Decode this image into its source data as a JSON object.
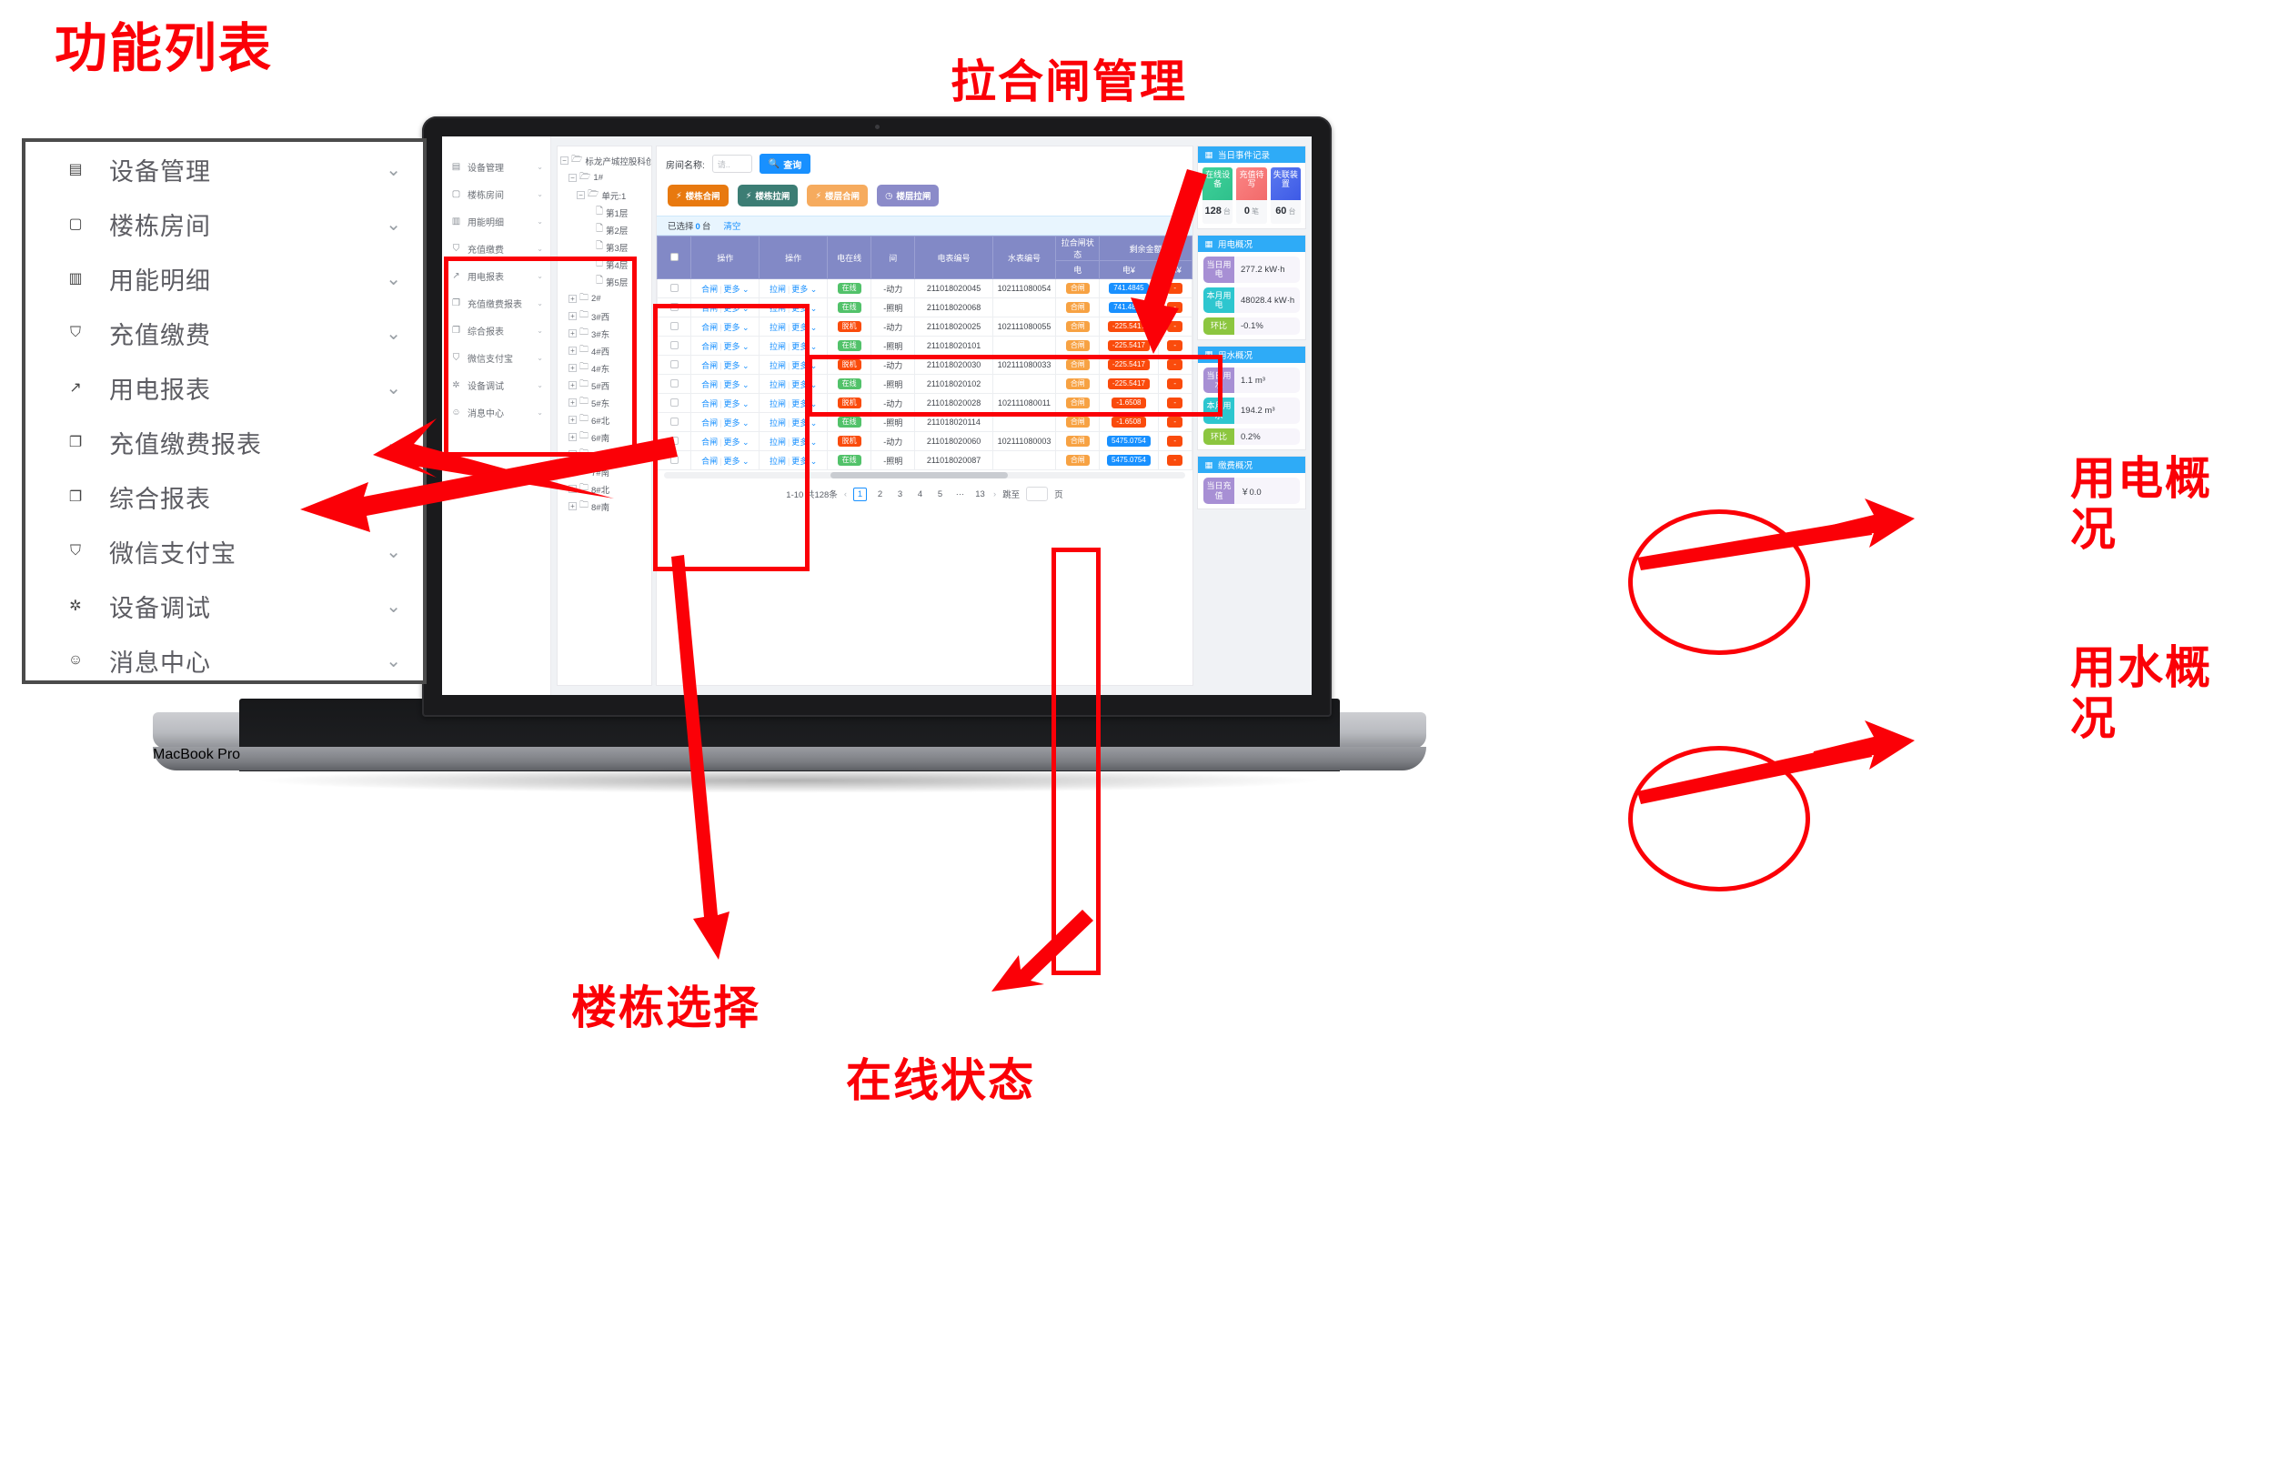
{
  "annotations": {
    "func_list": "功能列表",
    "gate_mgmt": "拉合闸管理",
    "power_overview": "用电概\n况",
    "water_overview": "用水概\n况",
    "building_select": "楼栋选择",
    "online_status": "在线状态"
  },
  "laptop": {
    "model_label": "MacBook Pro"
  },
  "func_list_panel": {
    "items": [
      {
        "label": "设备管理",
        "icon": "server-icon",
        "chevron": "chevron-down-icon"
      },
      {
        "label": "楼栋房间",
        "icon": "building-icon",
        "chevron": "chevron-down-icon"
      },
      {
        "label": "用能明细",
        "icon": "bar-chart-icon",
        "chevron": "chevron-down-icon"
      },
      {
        "label": "充值缴费",
        "icon": "shield-yen-icon",
        "chevron": "chevron-down-icon"
      },
      {
        "label": "用电报表",
        "icon": "trend-up-icon",
        "chevron": "chevron-down-icon"
      },
      {
        "label": "充值缴费报表",
        "icon": "copy-icon",
        "chevron": "chevron-down-icon"
      },
      {
        "label": "综合报表",
        "icon": "copy-icon",
        "chevron": "chevron-down-icon"
      },
      {
        "label": "微信支付宝",
        "icon": "shield-yen-icon",
        "chevron": "chevron-down-icon"
      },
      {
        "label": "设备调试",
        "icon": "gear-icon",
        "chevron": "chevron-down-icon"
      },
      {
        "label": "消息中心",
        "icon": "message-icon",
        "chevron": "chevron-down-icon"
      }
    ]
  },
  "app": {
    "sidebar": {
      "items": [
        {
          "label": "设备管理",
          "icon": "server-icon"
        },
        {
          "label": "楼栋房间",
          "icon": "building-icon"
        },
        {
          "label": "用能明细",
          "icon": "bar-chart-icon"
        },
        {
          "label": "充值缴费",
          "icon": "shield-yen-icon"
        },
        {
          "label": "用电报表",
          "icon": "trend-up-icon"
        },
        {
          "label": "充值缴费报表",
          "icon": "copy-icon"
        },
        {
          "label": "综合报表",
          "icon": "copy-icon"
        },
        {
          "label": "微信支付宝",
          "icon": "shield-yen-icon"
        },
        {
          "label": "设备调试",
          "icon": "gear-icon"
        },
        {
          "label": "消息中心",
          "icon": "message-icon"
        }
      ]
    },
    "tree": {
      "nodes": [
        {
          "label": "标龙产城控股科创园",
          "depth": 0,
          "switch": "−",
          "icon": "folder-open-icon"
        },
        {
          "label": "1#",
          "depth": 1,
          "switch": "−",
          "icon": "folder-open-icon"
        },
        {
          "label": "单元:1",
          "depth": 2,
          "switch": "−",
          "icon": "folder-open-icon"
        },
        {
          "label": "第1层",
          "depth": 3,
          "switch": "",
          "icon": "file-folder-icon"
        },
        {
          "label": "第2层",
          "depth": 3,
          "switch": "",
          "icon": "file-folder-icon"
        },
        {
          "label": "第3层",
          "depth": 3,
          "switch": "",
          "icon": "file-folder-icon"
        },
        {
          "label": "第4层",
          "depth": 3,
          "switch": "",
          "icon": "file-folder-icon"
        },
        {
          "label": "第5层",
          "depth": 3,
          "switch": "",
          "icon": "file-folder-icon"
        },
        {
          "label": "2#",
          "depth": 1,
          "switch": "+",
          "icon": "folder-icon"
        },
        {
          "label": "3#西",
          "depth": 1,
          "switch": "+",
          "icon": "folder-icon"
        },
        {
          "label": "3#东",
          "depth": 1,
          "switch": "+",
          "icon": "folder-icon"
        },
        {
          "label": "4#西",
          "depth": 1,
          "switch": "+",
          "icon": "folder-icon"
        },
        {
          "label": "4#东",
          "depth": 1,
          "switch": "+",
          "icon": "folder-icon"
        },
        {
          "label": "5#西",
          "depth": 1,
          "switch": "+",
          "icon": "folder-icon"
        },
        {
          "label": "5#东",
          "depth": 1,
          "switch": "+",
          "icon": "folder-icon"
        },
        {
          "label": "6#北",
          "depth": 1,
          "switch": "+",
          "icon": "folder-icon"
        },
        {
          "label": "6#南",
          "depth": 1,
          "switch": "+",
          "icon": "folder-icon"
        },
        {
          "label": "7#北",
          "depth": 1,
          "switch": "+",
          "icon": "folder-icon"
        },
        {
          "label": "7#南",
          "depth": 1,
          "switch": "+",
          "icon": "folder-icon"
        },
        {
          "label": "8#北",
          "depth": 1,
          "switch": "+",
          "icon": "folder-icon"
        },
        {
          "label": "8#南",
          "depth": 1,
          "switch": "+",
          "icon": "folder-icon"
        }
      ]
    },
    "search": {
      "label": "房间名称:",
      "placeholder": "请..",
      "value": "",
      "query_button": "查询",
      "query_icon": "search-icon"
    },
    "gate_buttons": [
      {
        "label": "楼栋合闸",
        "icon": "bolt-icon",
        "color": "#e8790f"
      },
      {
        "label": "楼栋拉闸",
        "icon": "bolt-icon",
        "color": "#3c7d74"
      },
      {
        "label": "楼层合闸",
        "icon": "bolt-icon",
        "color": "#f6ab5e"
      },
      {
        "label": "楼层拉闸",
        "icon": "clock-icon",
        "color": "#8b8bc9"
      }
    ],
    "selection_bar": {
      "prefix": "已选择",
      "count": "0",
      "suffix": "台",
      "clear": "清空"
    },
    "table": {
      "headers_top": [
        "",
        "操作",
        "操作",
        "电在线",
        "间",
        "电表编号",
        "水表编号",
        "拉合闸状态",
        "剩余金额",
        ""
      ],
      "headers_sub": [
        "电",
        "电¥",
        "水¥"
      ],
      "row_actions": {
        "close": "合闸",
        "more": "更多",
        "open": "拉闸",
        "more2": "更多"
      },
      "rows": [
        {
          "online": "在线",
          "online_color": "green",
          "room": "-动力",
          "elec_no": "211018020045",
          "water_no": "102111080054",
          "gate": "合闸",
          "elec_amt": "741.4845",
          "elec_amt_color": "blue",
          "water_amt": "-"
        },
        {
          "online": "在线",
          "online_color": "green",
          "room": "-照明",
          "elec_no": "211018020068",
          "water_no": "",
          "gate": "合闸",
          "elec_amt": "741.4845",
          "elec_amt_color": "blue",
          "water_amt": "-"
        },
        {
          "online": "脱机",
          "online_color": "red",
          "room": "-动力",
          "elec_no": "211018020025",
          "water_no": "102111080055",
          "gate": "合闸",
          "elec_amt": "-225.5417",
          "elec_amt_color": "deep",
          "water_amt": "-"
        },
        {
          "online": "在线",
          "online_color": "green",
          "room": "-照明",
          "elec_no": "211018020101",
          "water_no": "",
          "gate": "合闸",
          "elec_amt": "-225.5417",
          "elec_amt_color": "deep",
          "water_amt": "-"
        },
        {
          "online": "脱机",
          "online_color": "red",
          "room": "-动力",
          "elec_no": "211018020030",
          "water_no": "102111080033",
          "gate": "合闸",
          "elec_amt": "-225.5417",
          "elec_amt_color": "deep",
          "water_amt": "-"
        },
        {
          "online": "在线",
          "online_color": "green",
          "room": "-照明",
          "elec_no": "211018020102",
          "water_no": "",
          "gate": "合闸",
          "elec_amt": "-225.5417",
          "elec_amt_color": "deep",
          "water_amt": "-"
        },
        {
          "online": "脱机",
          "online_color": "red",
          "room": "-动力",
          "elec_no": "211018020028",
          "water_no": "102111080011",
          "gate": "合闸",
          "elec_amt": "-1.6508",
          "elec_amt_color": "deep",
          "water_amt": "-"
        },
        {
          "online": "在线",
          "online_color": "green",
          "room": "-照明",
          "elec_no": "211018020114",
          "water_no": "",
          "gate": "合闸",
          "elec_amt": "-1.6508",
          "elec_amt_color": "deep",
          "water_amt": "-"
        },
        {
          "online": "脱机",
          "online_color": "red",
          "room": "-动力",
          "elec_no": "211018020060",
          "water_no": "102111080003",
          "gate": "合闸",
          "elec_amt": "5475.0754",
          "elec_amt_color": "blue",
          "water_amt": "-"
        },
        {
          "online": "在线",
          "online_color": "green",
          "room": "-照明",
          "elec_no": "211018020087",
          "water_no": "",
          "gate": "合闸",
          "elec_amt": "5475.0754",
          "elec_amt_color": "blue",
          "water_amt": "-"
        }
      ]
    },
    "pagination": {
      "summary": "1-10 共128条",
      "prev": "‹",
      "pages": [
        "1",
        "2",
        "3",
        "4",
        "5",
        "···",
        "13"
      ],
      "current": "1",
      "next": "›",
      "jump_label": "跳至",
      "jump_value": "",
      "page_unit": "页"
    },
    "right_panel": {
      "events_card": {
        "title": "当日事件记录",
        "icon": "record-icon",
        "items": [
          {
            "caption": "在线设备",
            "value": "128",
            "unit": "台",
            "color_class": "g"
          },
          {
            "caption": "充值待写",
            "value": "0",
            "unit": "笔",
            "color_class": "r"
          },
          {
            "caption": "失联装置",
            "value": "60",
            "unit": "台",
            "color_class": "b"
          }
        ]
      },
      "power_card": {
        "title": "用电概况",
        "icon": "record-icon",
        "rows": [
          {
            "key": "当日用电",
            "value": "277.2 kW·h",
            "key_class": "p"
          },
          {
            "key": "本月用电",
            "value": "48028.4 kW·h",
            "key_class": "c"
          },
          {
            "key": "环比",
            "value": "-0.1%",
            "key_class": "gr"
          }
        ]
      },
      "water_card": {
        "title": "用水概况",
        "icon": "record-icon",
        "rows": [
          {
            "key": "当日用水",
            "value": "1.1 m³",
            "key_class": "p"
          },
          {
            "key": "本月用水",
            "value": "194.2 m³",
            "key_class": "c"
          },
          {
            "key": "环比",
            "value": "0.2%",
            "key_class": "gr"
          }
        ]
      },
      "pay_card": {
        "title": "缴费概况",
        "icon": "record-icon",
        "rows": [
          {
            "key": "当日充值",
            "value": "￥0.0",
            "key_class": "p"
          }
        ]
      }
    }
  }
}
